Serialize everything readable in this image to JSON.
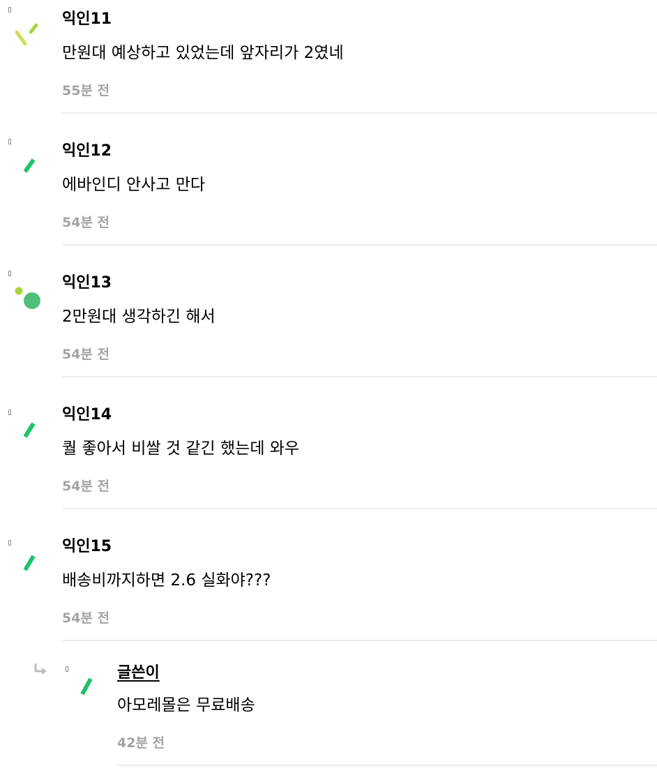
{
  "comments": [
    {
      "nickname": "익인11",
      "text": "만원대 예상하고 있었는데 앞자리가 2였네",
      "time": "55분 전",
      "avatar_icon": "yellow-green-dashes-icon"
    },
    {
      "nickname": "익인12",
      "text": "에바인디 안사고 만다",
      "time": "54분 전",
      "avatar_icon": "green-dash-icon"
    },
    {
      "nickname": "익인13",
      "text": "2만원대 생각하긴 해서",
      "time": "54분 전",
      "avatar_icon": "green-dots-icon"
    },
    {
      "nickname": "익인14",
      "text": "퀄 좋아서 비쌀 것 같긴 했는데 와우",
      "time": "54분 전",
      "avatar_icon": "green-dash-icon"
    },
    {
      "nickname": "익인15",
      "text": "배송비까지하면 2.6 실화야???",
      "time": "54분 전",
      "avatar_icon": "green-dash-icon"
    }
  ],
  "reply": {
    "nickname": "글쓴이",
    "text": "아모레몰은 무료배송",
    "time": "42분 전",
    "avatar_icon": "green-dash-icon",
    "reply_icon": "reply-arrow-icon"
  },
  "colors": {
    "accent_green": "#1ec26a",
    "light_green": "#a6d63c",
    "yellow_green": "#cfe05a",
    "dot_green": "#4fbf7a",
    "time_gray": "#a3a3a3",
    "divider": "#ebebeb"
  }
}
